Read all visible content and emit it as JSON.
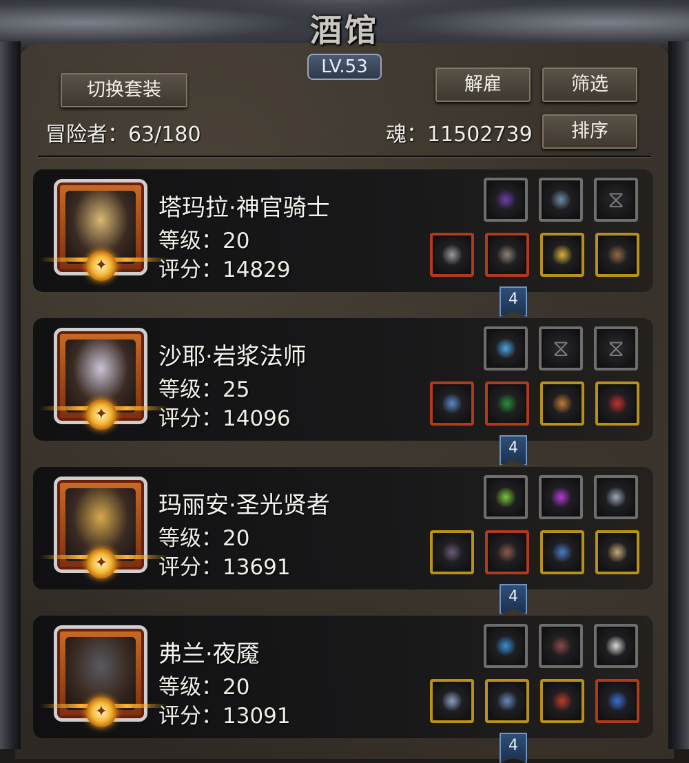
{
  "header": {
    "title": "酒馆",
    "level": "LV.53",
    "switch_outfit": "切换套装",
    "dismiss": "解雇",
    "filter": "筛选",
    "sort": "排序",
    "adventurers": "冒险者：63/180",
    "soul": "魂：11502739"
  },
  "heroes": [
    {
      "name": "塔玛拉·神官骑士",
      "level": "等级：20",
      "score": "评分：14829",
      "tag": "4",
      "portrait_color": "#d8b874",
      "items_top": [
        {
          "name": "dark-orb-icon",
          "color": "#6a3fa8",
          "rarity": "gray"
        },
        {
          "name": "tome-icon",
          "color": "#6f8aa3",
          "rarity": "gray"
        },
        {
          "name": "empty-slot-icon",
          "color": "",
          "rarity": "empty"
        }
      ],
      "items_bottom": [
        {
          "name": "hammer-icon",
          "color": "#9a9a9a",
          "rarity": "red"
        },
        {
          "name": "chest-armor-icon",
          "color": "#8b7f74",
          "rarity": "red"
        },
        {
          "name": "amulet-icon",
          "color": "#d9b23a",
          "rarity": "gold"
        },
        {
          "name": "mask-icon",
          "color": "#8f6a48",
          "rarity": "gold"
        }
      ]
    },
    {
      "name": "沙耶·岩浆法师",
      "level": "等级：25",
      "score": "评分：14096",
      "tag": "4",
      "portrait_color": "#c9c4d6",
      "items_top": [
        {
          "name": "frost-orb-icon",
          "color": "#4aa5e0",
          "rarity": "gray"
        },
        {
          "name": "empty-slot-icon",
          "color": "",
          "rarity": "empty"
        },
        {
          "name": "empty-slot-icon",
          "color": "",
          "rarity": "empty"
        }
      ],
      "items_bottom": [
        {
          "name": "staff-icon",
          "color": "#5d88c7",
          "rarity": "red"
        },
        {
          "name": "robe-icon",
          "color": "#2c8c3a",
          "rarity": "red"
        },
        {
          "name": "bracelet-icon",
          "color": "#c07a3a",
          "rarity": "gold"
        },
        {
          "name": "necklace-icon",
          "color": "#c23030",
          "rarity": "gold"
        }
      ]
    },
    {
      "name": "玛丽安·圣光贤者",
      "level": "等级：20",
      "score": "评分：13691",
      "tag": "4",
      "portrait_color": "#d4a94e",
      "items_top": [
        {
          "name": "green-crystal-icon",
          "color": "#7ac53a",
          "rarity": "gray"
        },
        {
          "name": "purple-gem-icon",
          "color": "#b23ad6",
          "rarity": "gray"
        },
        {
          "name": "badge-icon",
          "color": "#9aa6b8",
          "rarity": "gray"
        }
      ],
      "items_bottom": [
        {
          "name": "mace-icon",
          "color": "#6a5a78",
          "rarity": "gold"
        },
        {
          "name": "cloak-icon",
          "color": "#8b5a4a",
          "rarity": "red"
        },
        {
          "name": "pendant-icon",
          "color": "#4a7ac5",
          "rarity": "gold"
        },
        {
          "name": "scroll-icon",
          "color": "#c6a873",
          "rarity": "gold"
        }
      ]
    },
    {
      "name": "弗兰·夜魇",
      "level": "等级：20",
      "score": "评分：13091",
      "tag": "4",
      "portrait_color": "#5a5a60",
      "items_top": [
        {
          "name": "blue-rune-icon",
          "color": "#3a8ed6",
          "rarity": "gray"
        },
        {
          "name": "feather-icon",
          "color": "#8a4848",
          "rarity": "gray"
        },
        {
          "name": "stone-icon",
          "color": "#d8d8d8",
          "rarity": "gray"
        }
      ],
      "items_bottom": [
        {
          "name": "dagger-icon",
          "color": "#8aa0c0",
          "rarity": "gold"
        },
        {
          "name": "mail-armor-icon",
          "color": "#6a86b8",
          "rarity": "gold"
        },
        {
          "name": "ruby-ring-icon",
          "color": "#c03a2a",
          "rarity": "gold"
        },
        {
          "name": "arcane-orb-icon",
          "color": "#3a6ed6",
          "rarity": "red"
        }
      ]
    }
  ]
}
